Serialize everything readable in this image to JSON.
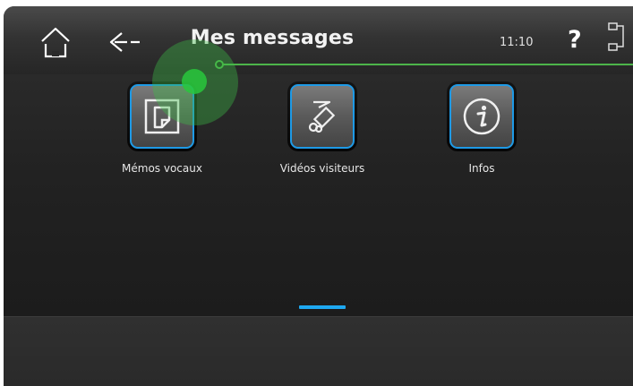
{
  "header": {
    "title": "Mes messages",
    "time": "11:10",
    "help_label": "?"
  },
  "tiles": [
    {
      "label": "Mémos vocaux",
      "icon": "voice-memo-icon"
    },
    {
      "label": "Vidéos visiteurs",
      "icon": "visitor-video-icon"
    },
    {
      "label": "Infos",
      "icon": "info-icon"
    }
  ],
  "colors": {
    "accent": "#1e9ae6",
    "touch_indicator": "#3cbe46",
    "background": "#232323"
  },
  "pagination": {
    "current_page": 1
  }
}
